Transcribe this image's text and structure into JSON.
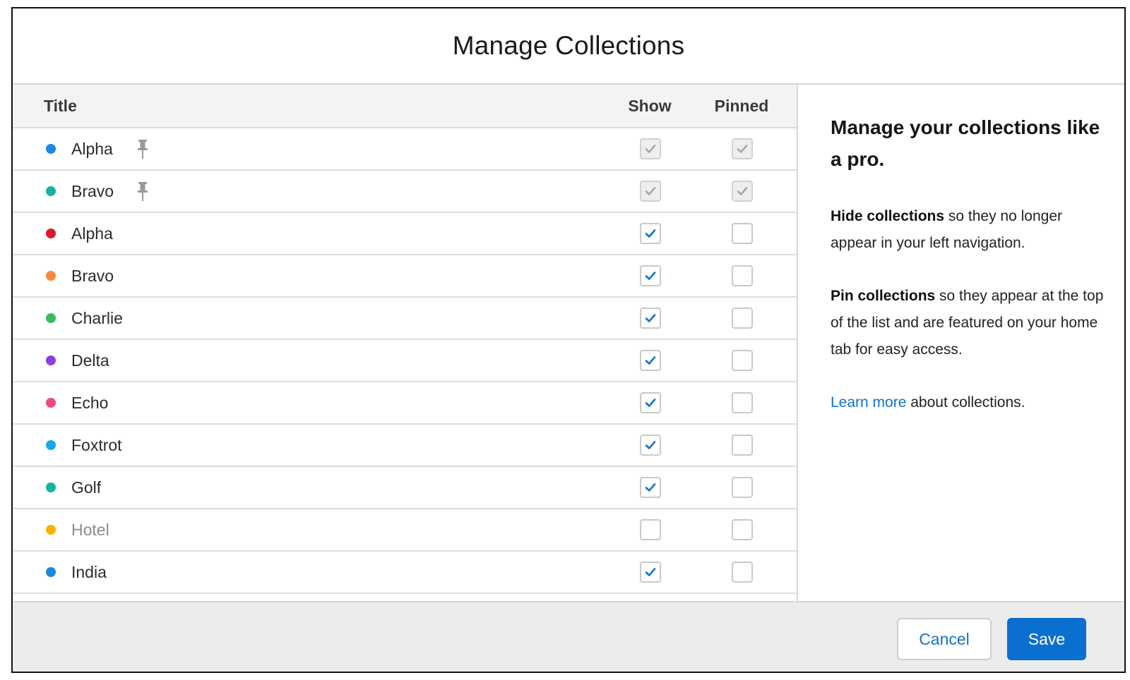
{
  "dialog": {
    "title": "Manage Collections"
  },
  "table": {
    "headers": {
      "title": "Title",
      "show": "Show",
      "pinned": "Pinned"
    },
    "rows": [
      {
        "label": "Alpha",
        "color": "#1e88e5",
        "pinned_icon": true,
        "show": true,
        "pinned": true,
        "locked": true,
        "muted": false
      },
      {
        "label": "Bravo",
        "color": "#1ab2a8",
        "pinned_icon": true,
        "show": true,
        "pinned": true,
        "locked": true,
        "muted": false
      },
      {
        "label": "Alpha",
        "color": "#e0162b",
        "pinned_icon": false,
        "show": true,
        "pinned": false,
        "locked": false,
        "muted": false
      },
      {
        "label": "Bravo",
        "color": "#f5893a",
        "pinned_icon": false,
        "show": true,
        "pinned": false,
        "locked": false,
        "muted": false
      },
      {
        "label": "Charlie",
        "color": "#3dbb5c",
        "pinned_icon": false,
        "show": true,
        "pinned": false,
        "locked": false,
        "muted": false
      },
      {
        "label": "Delta",
        "color": "#8a3fe0",
        "pinned_icon": false,
        "show": true,
        "pinned": false,
        "locked": false,
        "muted": false
      },
      {
        "label": "Echo",
        "color": "#ee4b7a",
        "pinned_icon": false,
        "show": true,
        "pinned": false,
        "locked": false,
        "muted": false
      },
      {
        "label": "Foxtrot",
        "color": "#1aa6ec",
        "pinned_icon": false,
        "show": true,
        "pinned": false,
        "locked": false,
        "muted": false
      },
      {
        "label": "Golf",
        "color": "#17b3a3",
        "pinned_icon": false,
        "show": true,
        "pinned": false,
        "locked": false,
        "muted": false
      },
      {
        "label": "Hotel",
        "color": "#f6b400",
        "pinned_icon": false,
        "show": false,
        "pinned": false,
        "locked": false,
        "muted": true
      },
      {
        "label": "India",
        "color": "#1e88e5",
        "pinned_icon": false,
        "show": true,
        "pinned": false,
        "locked": false,
        "muted": false
      }
    ]
  },
  "info": {
    "heading": "Manage your collections like a pro.",
    "hide_bold": "Hide collections",
    "hide_text": " so they no longer appear in your left navigation.",
    "pin_bold": "Pin collections",
    "pin_text": " so they appear at the top of the list and are featured on your home tab for easy access.",
    "learn_link": "Learn more",
    "learn_text": " about collections."
  },
  "footer": {
    "cancel_label": "Cancel",
    "save_label": "Save"
  },
  "colors": {
    "check_blue": "#1273c9",
    "check_grey": "#a7a7a7",
    "primary": "#0b6fd0"
  },
  "icons": {
    "pin": "pin-icon",
    "check": "checkmark-icon"
  }
}
